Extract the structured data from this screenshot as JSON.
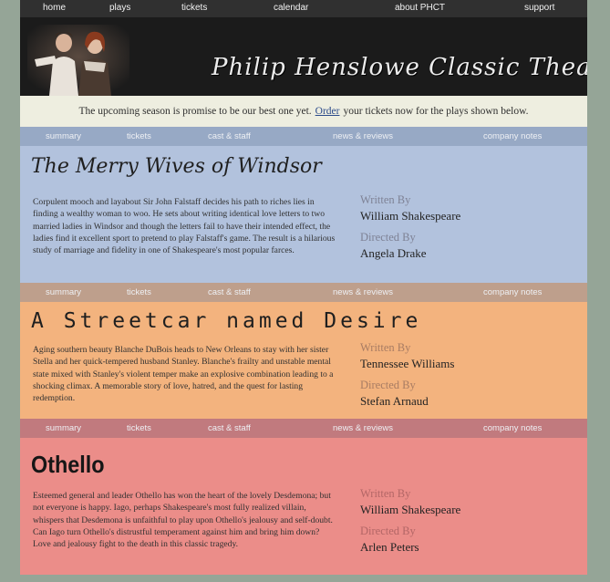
{
  "topnav": {
    "items": [
      "home",
      "plays",
      "tickets",
      "calendar",
      "about PHCT",
      "support"
    ]
  },
  "banner": {
    "title": "Philip Henslowe Classic Theatre"
  },
  "intro": {
    "before": "The upcoming season is promise to be our best one yet.",
    "link": "Order",
    "after": "your tickets now for the plays shown below."
  },
  "subnav": {
    "items": [
      "summary",
      "tickets",
      "cast & staff",
      "news & reviews",
      "company notes"
    ]
  },
  "labels": {
    "written_by": "Written By",
    "directed_by": "Directed By"
  },
  "plays": [
    {
      "title": "The Merry Wives of Windsor",
      "description": "Corpulent mooch and layabout Sir John Falstaff decides his path to riches lies in finding a wealthy woman to woo. He sets about writing identical love letters to two married ladies in Windsor and though the letters fail to have their intended effect, the ladies find it excellent sport to pretend to play Falstaff's game. The result is a hilarious study of marriage and fidelity in one of Shakespeare's most popular farces.",
      "writer": "William Shakespeare",
      "director": "Angela Drake"
    },
    {
      "title": "A Streetcar named Desire",
      "description": "Aging southern beauty Blanche DuBois heads to New Orleans to stay with her sister Stella and her quick-tempered husband Stanley. Blanche's frailty and unstable mental state mixed with Stanley's violent temper make an explosive combination leading to a shocking climax. A memorable story of love, hatred, and the quest for lasting redemption.",
      "writer": "Tennessee Williams",
      "director": "Stefan Arnaud"
    },
    {
      "title": "Othello",
      "description": "Esteemed general and leader Othello has won the heart of the lovely Desdemona; but not everyone is happy. Iago, perhaps Shakespeare's most fully realized villain, whispers that Desdemona is unfaithful to play upon Othello's jealousy and self-doubt. Can Iago turn Othello's distrustful temperament against him and bring him down? Love and jealousy fight to the death in this classic tragedy.",
      "writer": "William Shakespeare",
      "director": "Arlen Peters"
    }
  ],
  "colors": {
    "page_background": "#95a597",
    "nav_background": "#303030",
    "play1_background": "#b2c2dd",
    "play2_background": "#f3b37e",
    "play3_background": "#eb8d89"
  }
}
